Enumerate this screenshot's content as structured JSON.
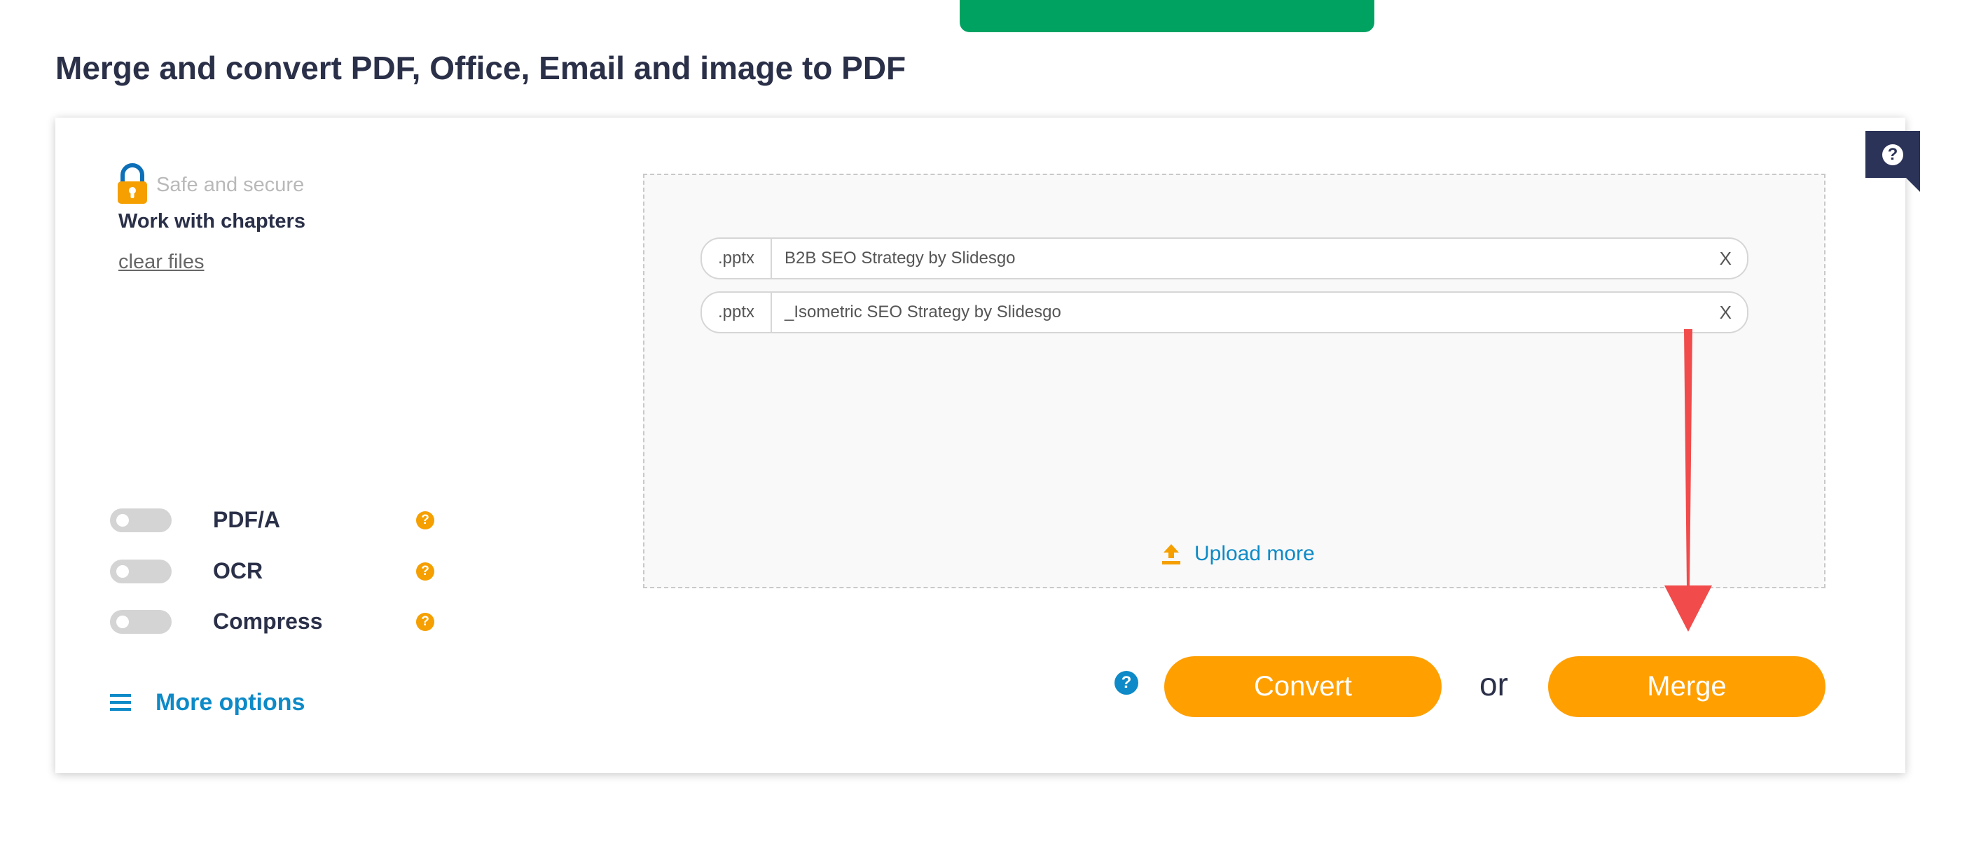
{
  "page": {
    "title": "Merge and convert PDF, Office, Email and image to PDF"
  },
  "sidebar": {
    "safe_text": "Safe and secure",
    "chapters_text": "Work with chapters",
    "clear_files": "clear files",
    "options": [
      {
        "label": "PDF/A",
        "enabled": false,
        "help": "?"
      },
      {
        "label": "OCR",
        "enabled": false,
        "help": "?"
      },
      {
        "label": "Compress",
        "enabled": false,
        "help": "?"
      }
    ],
    "more_options": "More options"
  },
  "files": [
    {
      "ext": ".pptx",
      "name": "B2B SEO Strategy by Slidesgo",
      "remove": "X"
    },
    {
      "ext": ".pptx",
      "name": "_Isometric SEO Strategy by Slidesgo",
      "remove": "X"
    }
  ],
  "upload_more": "Upload more",
  "actions": {
    "help": "?",
    "convert": "Convert",
    "or": "or",
    "merge": "Merge"
  },
  "help_tab": "?",
  "colors": {
    "primary_green": "#00a262",
    "accent_orange": "#ff9f00",
    "link_blue": "#0d8ac7",
    "text_dark": "#2b3049",
    "help_tab_navy": "#2b3359",
    "annotation_red": "#f14b4b"
  },
  "icons": [
    "lock-icon",
    "question-circle-icon",
    "hamburger-menu-icon",
    "upload-icon",
    "arrow-down-annotation"
  ]
}
